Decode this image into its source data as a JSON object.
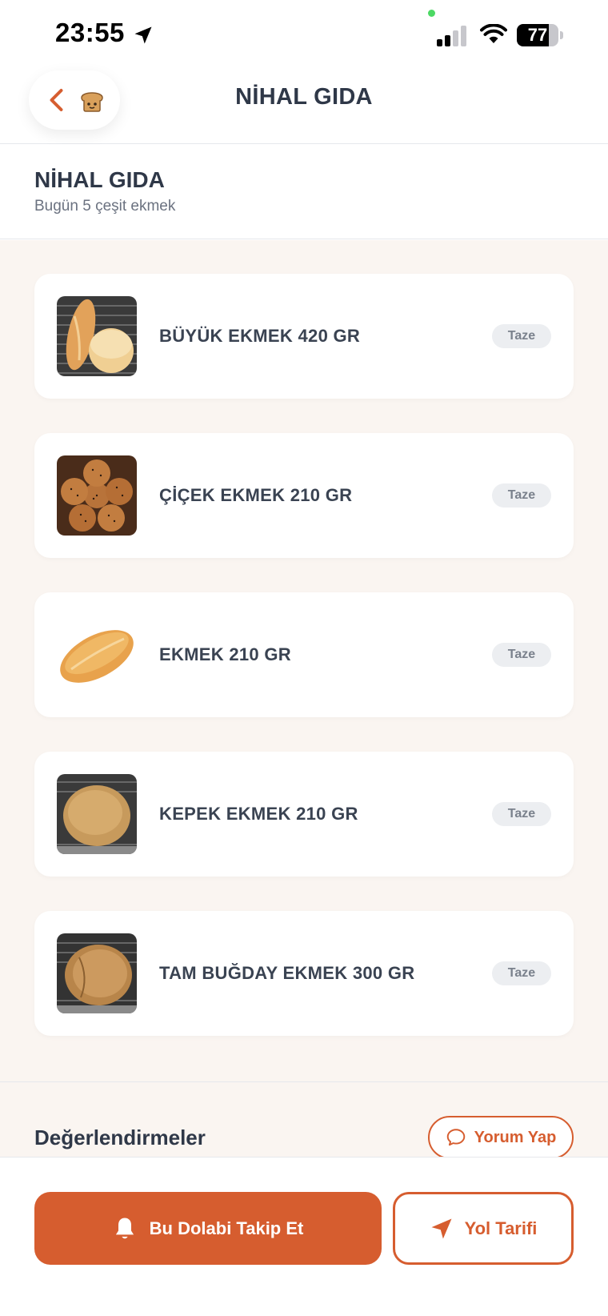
{
  "status_bar": {
    "time": "23:55",
    "battery": "77",
    "battery_level": 0.77
  },
  "header": {
    "title": "NİHAL GIDA",
    "back_icon": "chevron-left-icon",
    "shop_icon": "bread-icon"
  },
  "store": {
    "name": "NİHAL GIDA",
    "subtitle": "Bugün 5 çeşit ekmek"
  },
  "products": [
    {
      "name": "BÜYÜK EKMEK 420 GR",
      "badge": "Taze"
    },
    {
      "name": "ÇİÇEK EKMEK 210 GR",
      "badge": "Taze"
    },
    {
      "name": "EKMEK 210 GR",
      "badge": "Taze"
    },
    {
      "name": "KEPEK EKMEK 210 GR",
      "badge": "Taze"
    },
    {
      "name": "TAM BUĞDAY EKMEK 300 GR",
      "badge": "Taze"
    }
  ],
  "reviews": {
    "title": "Değerlendirmeler",
    "button_label": "Yorum Yap"
  },
  "actions": {
    "follow_label": "Bu Dolabi Takip Et",
    "directions_label": "Yol Tarifi"
  },
  "colors": {
    "accent": "#d65d2f",
    "text": "#2f3848",
    "list_background": "#faf5f1",
    "badge_background": "#eceef1"
  }
}
